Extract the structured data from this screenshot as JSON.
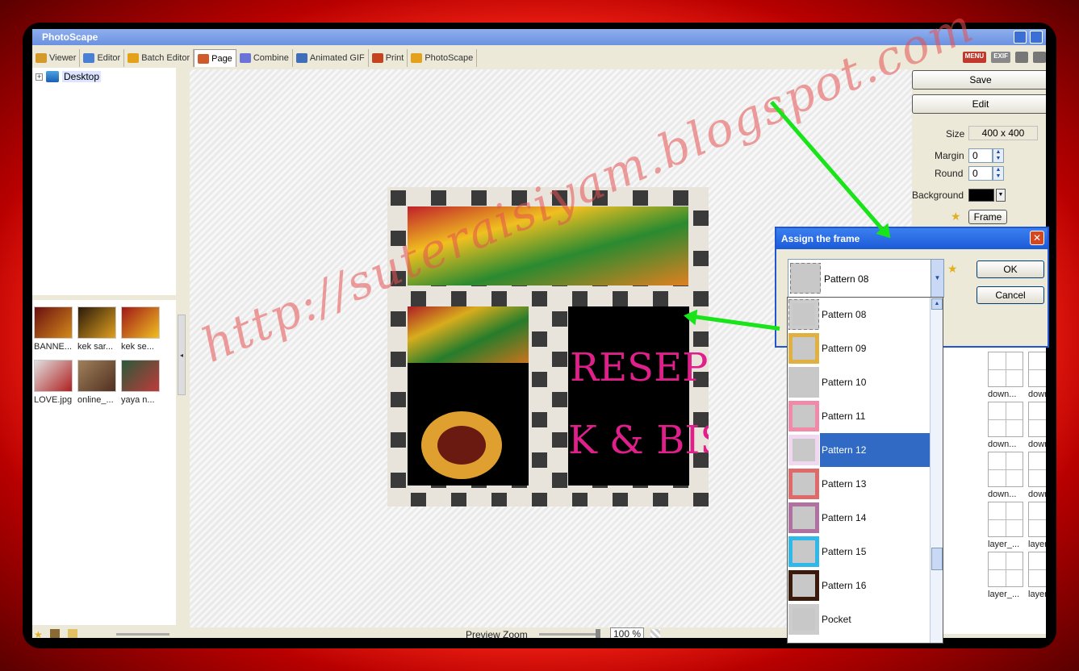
{
  "window": {
    "title": "PhotoScape"
  },
  "tabs": [
    {
      "label": "Viewer",
      "icon": "viewer-icon",
      "color": "#d39a2a"
    },
    {
      "label": "Editor",
      "icon": "editor-icon",
      "color": "#4a7fd6"
    },
    {
      "label": "Batch Editor",
      "icon": "batch-editor-icon",
      "color": "#e3a11c"
    },
    {
      "label": "Page",
      "icon": "page-icon",
      "color": "#d15a2a"
    },
    {
      "label": "Combine",
      "icon": "combine-icon",
      "color": "#6b72d8"
    },
    {
      "label": "Animated GIF",
      "icon": "animated-gif-icon",
      "color": "#3e6fb8"
    },
    {
      "label": "Print",
      "icon": "print-icon",
      "color": "#c4441f"
    },
    {
      "label": "PhotoScape",
      "icon": "photoscape-icon",
      "color": "#e3a11c"
    }
  ],
  "top_icons": {
    "menu": "MENU",
    "exif": "EXIF"
  },
  "tree": {
    "root": "Desktop"
  },
  "thumbnails": [
    {
      "caption": "BANNE...",
      "c1": "#6b1010",
      "c2": "#d48a1a"
    },
    {
      "caption": "kek sar...",
      "c1": "#2a1a0a",
      "c2": "#e0a020"
    },
    {
      "caption": "kek se...",
      "c1": "#a01818",
      "c2": "#f0c020"
    },
    {
      "caption": "LOVE.jpg",
      "c1": "#e0e0e0",
      "c2": "#b02020"
    },
    {
      "caption": "online_...",
      "c1": "#a0805a",
      "c2": "#503020"
    },
    {
      "caption": "yaya n...",
      "c1": "#2a5a3a",
      "c2": "#c03a3a"
    }
  ],
  "right_panel": {
    "save_label": "Save",
    "edit_label": "Edit",
    "size_label": "Size",
    "size_value": "400 x 400",
    "margin_label": "Margin",
    "margin_value": "0",
    "round_label": "Round",
    "round_value": "0",
    "background_label": "Background",
    "background_color": "#000000",
    "frame_label": "Frame"
  },
  "layouts": [
    "down...",
    "down...",
    "down...",
    "down...",
    "down...",
    "down...",
    "layer_...",
    "layer_...",
    "layer_...",
    "layer_..."
  ],
  "dialog": {
    "title": "Assign the frame",
    "selected": "Pattern 08",
    "ok_label": "OK",
    "cancel_label": "Cancel"
  },
  "dropdown_items": [
    {
      "label": "Pattern 08",
      "style": "checker",
      "color": "#cccccc"
    },
    {
      "label": "Pattern 09",
      "style": "gold",
      "color": "#e0b040"
    },
    {
      "label": "Pattern 10",
      "style": "plain",
      "color": "#c8c8c8"
    },
    {
      "label": "Pattern 11",
      "style": "pink",
      "color": "#f08aa8"
    },
    {
      "label": "Pattern 12",
      "style": "lilac",
      "color": "#f0d8f0",
      "selected": true
    },
    {
      "label": "Pattern 13",
      "style": "red",
      "color": "#e06a6a"
    },
    {
      "label": "Pattern 14",
      "style": "purple",
      "color": "#b070a0"
    },
    {
      "label": "Pattern 15",
      "style": "cyan",
      "color": "#30b8e8"
    },
    {
      "label": "Pattern 16",
      "style": "brown",
      "color": "#3a1a0a"
    },
    {
      "label": "Pocket",
      "style": "pocket",
      "color": "#cccccc"
    }
  ],
  "bottom": {
    "zoom_label": "Preview Zoom",
    "zoom_value": "100 %"
  },
  "collage": {
    "text1": "RESEPI",
    "text2": "K & BIS"
  },
  "watermark": "http://suteraisiyam.blogspot.com",
  "colors": {
    "accent": "#316ac5",
    "arrow": "#19e419",
    "border": "#e01010"
  }
}
